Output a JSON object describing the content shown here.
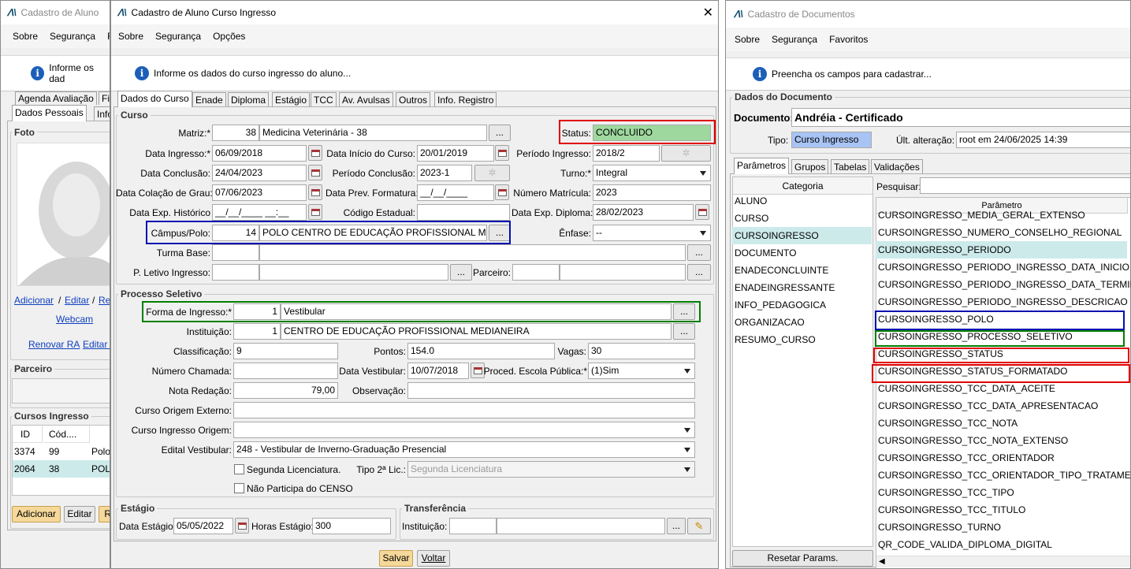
{
  "left": {
    "title": "Cadastro de Aluno",
    "menu": [
      "Sobre",
      "Segurança",
      "F"
    ],
    "info": "Informe os dad",
    "tabs_row1": [
      "Agenda Avaliação",
      "Fi"
    ],
    "tabs_row2": [
      "Dados Pessoais",
      "Info"
    ],
    "foto_label": "Foto",
    "links": [
      "Adicionar",
      "Editar",
      "Ren"
    ],
    "webcam": "Webcam",
    "renovar": "Renovar RA",
    "editar2": "Editar I",
    "parceiro": "Parceiro",
    "cursos_label": "Cursos Ingresso",
    "cols": [
      "ID",
      "Cód...."
    ],
    "rows": [
      {
        "id": "3374",
        "cod": "99",
        "polo": "Polo"
      },
      {
        "id": "2064",
        "cod": "38",
        "polo": "POL"
      }
    ],
    "btn_add": "Adicionar",
    "btn_edit": "Editar",
    "btn_re": "Re"
  },
  "mid": {
    "title": "Cadastro de Aluno Curso Ingresso",
    "menu": [
      "Sobre",
      "Segurança",
      "Opções"
    ],
    "info": "Informe os dados do curso ingresso do aluno...",
    "tabs": [
      "Dados do Curso",
      "Enade",
      "Diploma",
      "Estágio",
      "TCC",
      "Av. Avulsas",
      "Outros",
      "Info. Registro"
    ],
    "curso": {
      "label": "Curso",
      "matriz_l": "Matriz:*",
      "matriz_code": "38",
      "matriz": "Medicina Veterinária - 38",
      "status_l": "Status:",
      "status": "CONCLUIDO",
      "data_ingresso_l": "Data Ingresso:*",
      "data_ingresso": "06/09/2018",
      "data_inicio_l": "Data Início do Curso:",
      "data_inicio": "20/01/2019",
      "periodo_ingresso_l": "Período Ingresso:",
      "periodo_ingresso": "2018/2",
      "data_conclusao_l": "Data Conclusão:",
      "data_conclusao": "24/04/2023",
      "periodo_conclusao_l": "Período Conclusão:",
      "periodo_conclusao": "2023-1",
      "turno_l": "Turno:*",
      "turno": "Integral",
      "data_colacao_l": "Data Colação de Grau:",
      "data_colacao": "07/06/2023",
      "data_prev_l": "Data Prev. Formatura:",
      "data_prev": "__/__/____",
      "numero_matricula_l": "Número Matrícula:",
      "numero_matricula": "2023",
      "data_exp_hist_l": "Data Exp. Histórico",
      "data_exp_hist": "__/__/____ __:__",
      "codigo_estadual_l": "Código Estadual:",
      "codigo_estadual": "",
      "data_exp_diploma_l": "Data Exp. Diploma:",
      "data_exp_diploma": "28/02/2023",
      "campus_l": "Câmpus/Polo:",
      "campus_code": "14",
      "campus": "POLO CENTRO DE EDUCAÇÃO PROFISSIONAL MEDIANEIRA",
      "enfase_l": "Ênfase:",
      "enfase": "--",
      "turma_base_l": "Turma Base:",
      "p_letivo_l": "P. Letivo Ingresso:",
      "parceiro_l": "Parceiro:"
    },
    "processo": {
      "label": "Processo Seletivo",
      "forma_l": "Forma de Ingresso:*",
      "forma_code": "1",
      "forma": "Vestibular",
      "inst_l": "Instituição:",
      "inst_code": "1",
      "inst": "CENTRO DE EDUCAÇÃO PROFISSIONAL MEDIANEIRA",
      "class_l": "Classificação:",
      "class": "9",
      "pontos_l": "Pontos:",
      "pontos": "154.0",
      "vagas_l": "Vagas:",
      "vagas": "30",
      "num_chamada_l": "Número Chamada:",
      "num_chamada": "",
      "data_vest_l": "Data Vestibular:",
      "data_vest": "10/07/2018",
      "proced_l": "Proced. Escola Pública:*",
      "proced": "(1)Sim",
      "nota_l": "Nota Redação:",
      "nota": "79,00",
      "obs_l": "Observação:",
      "obs": "",
      "curso_origem_ext_l": "Curso Origem Externo:",
      "curso_ing_origem_l": "Curso Ingresso Origem:",
      "edital_l": "Edital Vestibular:",
      "edital": "248 - Vestibular de Inverno-Graduação Presencial",
      "seg_lic": "Segunda Licenciatura.",
      "tipo2_l": "Tipo 2ª Lic.:",
      "tipo2": "Segunda Licenciatura",
      "censo": "Não Participa do CENSO"
    },
    "estagio": {
      "label": "Estágio",
      "data_l": "Data Estágio:",
      "data": "05/05/2022",
      "horas_l": "Horas Estágio:",
      "horas": "300"
    },
    "transf": {
      "label": "Transferência",
      "inst_l": "Instituição:"
    },
    "salvar": "Salvar",
    "voltar": "Voltar",
    "ellipsis": "..."
  },
  "right": {
    "title": "Cadastro de Documentos",
    "menu": [
      "Sobre",
      "Segurança",
      "Favoritos"
    ],
    "info": "Preencha os campos para cadastrar...",
    "dados_label": "Dados do Documento",
    "doc_l": "Documento:",
    "doc": "Andréia - Certificado",
    "tipo_l": "Tipo:",
    "tipo": "Curso Ingresso",
    "ult_l": "Últ. alteração:",
    "ult": "root em 24/06/2025 14:39",
    "tabs": [
      "Parâmetros",
      "Grupos",
      "Tabelas",
      "Validações"
    ],
    "categoria_h": "Categoria",
    "categorias": [
      "ALUNO",
      "CURSO",
      "CURSOINGRESSO",
      "DOCUMENTO",
      "ENADECONCLUINTE",
      "ENADEINGRESSANTE",
      "INFO_PEDAGOGICA",
      "ORGANIZACAO",
      "RESUMO_CURSO"
    ],
    "pesquisar_l": "Pesquisar:",
    "param_h": "Parâmetro",
    "params": [
      "CURSOINGRESSO_MEDIA_GERAL_EXTENSO",
      "CURSOINGRESSO_NUMERO_CONSELHO_REGIONAL",
      "CURSOINGRESSO_PERIODO",
      "CURSOINGRESSO_PERIODO_INGRESSO_DATA_INICIO",
      "CURSOINGRESSO_PERIODO_INGRESSO_DATA_TERMINO",
      "CURSOINGRESSO_PERIODO_INGRESSO_DESCRICAO",
      "CURSOINGRESSO_POLO",
      "CURSOINGRESSO_PROCESSO_SELETIVO",
      "CURSOINGRESSO_STATUS",
      "CURSOINGRESSO_STATUS_FORMATADO",
      "CURSOINGRESSO_TCC_DATA_ACEITE",
      "CURSOINGRESSO_TCC_DATA_APRESENTACAO",
      "CURSOINGRESSO_TCC_NOTA",
      "CURSOINGRESSO_TCC_NOTA_EXTENSO",
      "CURSOINGRESSO_TCC_ORIENTADOR",
      "CURSOINGRESSO_TCC_ORIENTADOR_TIPO_TRATAMENTO",
      "CURSOINGRESSO_TCC_TIPO",
      "CURSOINGRESSO_TCC_TITULO",
      "CURSOINGRESSO_TURNO",
      "QR_CODE_VALIDA_DIPLOMA_DIGITAL"
    ],
    "resetar": "Resetar Params."
  },
  "colors": {
    "red": "#e00000",
    "blue": "#0010b0",
    "green": "#008000",
    "status_bg": "#9ed89e",
    "selected_row": "#cdeaea",
    "tipo_bg": "#a8c4f4"
  }
}
